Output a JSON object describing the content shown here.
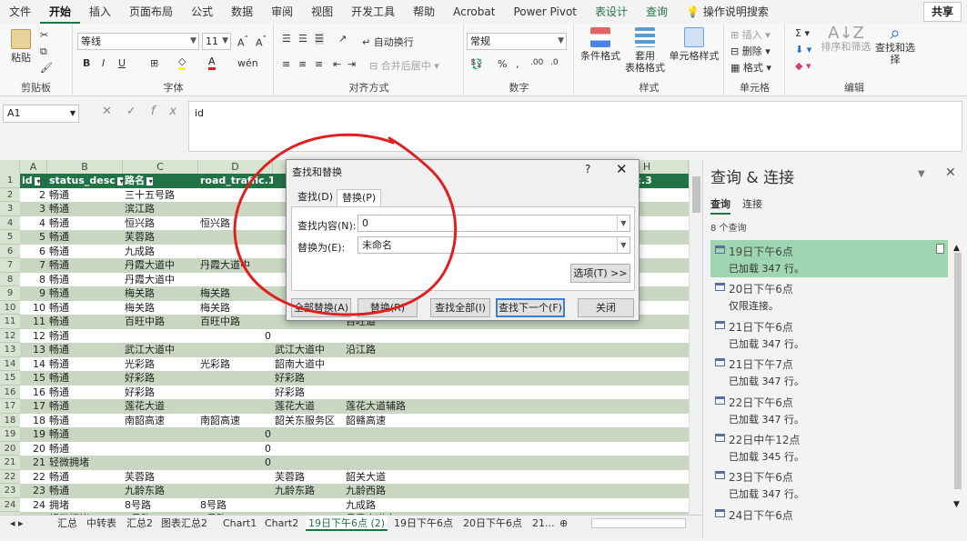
{
  "menu": {
    "tabs": [
      "文件",
      "开始",
      "插入",
      "页面布局",
      "公式",
      "数据",
      "审阅",
      "视图",
      "开发工具",
      "帮助",
      "Acrobat",
      "Power Pivot",
      "表设计",
      "查询"
    ],
    "active": "开始",
    "tell_me": "操作说明搜索",
    "share": "共享"
  },
  "ribbon": {
    "clipboard": {
      "label": "剪贴板",
      "paste": "粘贴"
    },
    "font": {
      "label": "字体",
      "name": "等线",
      "size": "11",
      "bold": "B",
      "italic": "I",
      "underline": "U"
    },
    "alignment": {
      "label": "对齐方式",
      "wrap": "自动换行",
      "merge": "合并后居中"
    },
    "number": {
      "label": "数字",
      "format": "常规"
    },
    "styles": {
      "label": "样式",
      "conditional": "条件格式",
      "table": "套用\n表格格式",
      "cell": "单元格样式"
    },
    "cells": {
      "label": "单元格",
      "insert": "插入",
      "delete": "删除",
      "format": "格式"
    },
    "editing": {
      "label": "编辑",
      "sort": "排序和筛选",
      "find": "查找和选择"
    }
  },
  "formula_bar": {
    "name_box": "A1",
    "fx": "fx",
    "value": "id"
  },
  "grid": {
    "columns": [
      "A",
      "B",
      "C",
      "D",
      "E",
      "F",
      "G",
      "H",
      "I"
    ],
    "header": [
      "id",
      "status_desc",
      "路名",
      "road_traffic.1",
      "",
      "",
      "",
      "",
      "traffic.3"
    ],
    "rows": [
      [
        "2",
        "2",
        "畅通",
        "三十五号路",
        "",
        "",
        ""
      ],
      [
        "3",
        "3",
        "畅通",
        "滨江路",
        "",
        "",
        "道"
      ],
      [
        "4",
        "4",
        "畅通",
        "恒兴路",
        "恒兴路",
        "",
        "道"
      ],
      [
        "5",
        "5",
        "畅通",
        "芙蓉路",
        "",
        "",
        "道南"
      ],
      [
        "6",
        "6",
        "畅通",
        "九成路",
        "",
        "",
        "路"
      ],
      [
        "7",
        "7",
        "畅通",
        "丹霞大道中",
        "丹霞大道中",
        "",
        "路"
      ],
      [
        "8",
        "8",
        "畅通",
        "丹霞大道中",
        "",
        "",
        "路"
      ],
      [
        "9",
        "9",
        "畅通",
        "梅关路",
        "梅关路",
        "",
        ""
      ],
      [
        "10",
        "10",
        "畅通",
        "梅关路",
        "梅关路",
        "",
        ""
      ],
      [
        "11",
        "11",
        "畅通",
        "百旺中路",
        "百旺中路",
        "",
        "百旺道"
      ],
      [
        "12",
        "12",
        "畅通",
        "",
        "0",
        "",
        ""
      ],
      [
        "13",
        "13",
        "畅通",
        "武江大道中",
        "",
        "武江大道中",
        "沿江路"
      ],
      [
        "14",
        "14",
        "畅通",
        "光彩路",
        "光彩路",
        "韶南大道中",
        ""
      ],
      [
        "15",
        "15",
        "畅通",
        "好彩路",
        "",
        "好彩路",
        ""
      ],
      [
        "16",
        "16",
        "畅通",
        "好彩路",
        "",
        "好彩路",
        ""
      ],
      [
        "17",
        "17",
        "畅通",
        "莲花大道",
        "",
        "莲花大道",
        "莲花大道辅路"
      ],
      [
        "18",
        "18",
        "畅通",
        "南韶高速",
        "南韶高速",
        "韶关东服务区",
        "韶赣高速"
      ],
      [
        "19",
        "19",
        "畅通",
        "",
        "0",
        "",
        ""
      ],
      [
        "20",
        "20",
        "畅通",
        "",
        "0",
        "",
        ""
      ],
      [
        "21",
        "21",
        "轻微拥堵",
        "",
        "0",
        "",
        ""
      ],
      [
        "22",
        "22",
        "畅通",
        "芙蓉路",
        "",
        "芙蓉路",
        "韶关大道"
      ],
      [
        "23",
        "23",
        "畅通",
        "九龄东路",
        "",
        "九龄东路",
        "九龄西路"
      ],
      [
        "24",
        "24",
        "拥堵",
        "8号路",
        "8号路",
        "",
        "九成路"
      ],
      [
        "25",
        "25",
        "轻微拥堵",
        "8号路",
        "8号路",
        "",
        "丹霞大道中"
      ],
      [
        "26",
        "26",
        "畅通",
        "丹霞大道中",
        "",
        "丹霞大道中",
        "百旺中路"
      ]
    ]
  },
  "sheet_tabs": [
    "汇总",
    "中转表",
    "汇总2",
    "图表汇总2",
    "Chart1",
    "Chart2",
    "19日下午6点 (2)",
    "19日下午6点",
    "20日下午6点",
    "21..."
  ],
  "active_sheet": "19日下午6点 (2)",
  "query_pane": {
    "title": "查询 & 连接",
    "tabs": [
      "查询",
      "连接"
    ],
    "count": "8 个查询",
    "items": [
      {
        "name": "19日下午6点",
        "status": "已加载 347 行。",
        "selected": true
      },
      {
        "name": "20日下午6点",
        "status": "仅限连接。",
        "selected": false
      },
      {
        "name": "21日下午6点",
        "status": "已加载 347 行。",
        "selected": false
      },
      {
        "name": "21日下午7点",
        "status": "已加载 347 行。",
        "selected": false
      },
      {
        "name": "22日下午6点",
        "status": "已加载 347 行。",
        "selected": false
      },
      {
        "name": "22日中午12点",
        "status": "已加载 345 行。",
        "selected": false
      },
      {
        "name": "23日下午6点",
        "status": "已加载 347 行。",
        "selected": false
      },
      {
        "name": "24日下午6点",
        "status": "",
        "selected": false
      }
    ]
  },
  "dialog": {
    "title": "查找和替换",
    "help": "?",
    "close": "✕",
    "tabs": [
      "查找(D)",
      "替换(P)"
    ],
    "active_tab": "替换(P)",
    "find_label": "查找内容(N):",
    "find_value": "0",
    "replace_label": "替换为(E):",
    "replace_value": "未命名",
    "options": "选项(T) >>",
    "buttons": {
      "replace_all": "全部替换(A)",
      "replace": "替换(R)",
      "find_all": "查找全部(I)",
      "find_next": "查找下一个(F)",
      "close": "关闭"
    }
  },
  "colors": {
    "accent": "#217346",
    "band": "#c9d7c2",
    "selected_query": "#9fd5b1",
    "annotation": "#e02020"
  }
}
